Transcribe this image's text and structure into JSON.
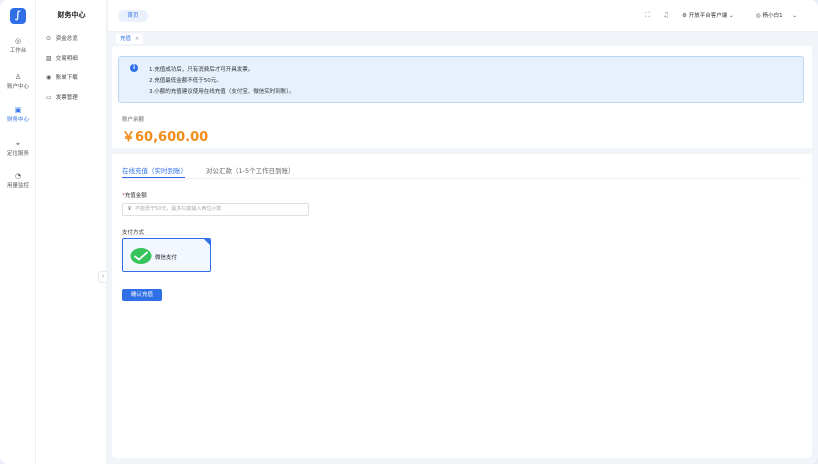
{
  "app": {
    "logo_glyph": "∫",
    "brand_color": "#2f6fe8"
  },
  "rail": {
    "items": [
      {
        "icon": "dashboard-icon",
        "glyph": "◎",
        "label": "工作台"
      },
      {
        "icon": "user-icon",
        "glyph": "♙",
        "label": "账户中心"
      },
      {
        "icon": "finance-icon",
        "glyph": "▣",
        "label": "财务中心",
        "active": true
      },
      {
        "icon": "location-icon",
        "glyph": "⌖",
        "label": "定位服务"
      },
      {
        "icon": "usage-icon",
        "glyph": "◔",
        "label": "用量监控"
      }
    ]
  },
  "submenu": {
    "title": "财务中心",
    "items": [
      {
        "icon": "fund-icon",
        "glyph": "⊙",
        "label": "资金总览"
      },
      {
        "icon": "transaction-icon",
        "glyph": "▨",
        "label": "交易明细"
      },
      {
        "icon": "download-icon",
        "glyph": "◉",
        "label": "账单下载"
      },
      {
        "icon": "invoice-icon",
        "glyph": "▭",
        "label": "发票管理"
      }
    ],
    "collapse_glyph": "‹"
  },
  "topbar": {
    "home_label": "首页",
    "fullscreen_glyph": "⛶",
    "bell_glyph": "♫",
    "platform_glyph": "⚙",
    "platform_label": "开放平台客户端",
    "user_glyph": "◎",
    "user_label": "杨小白1",
    "chevron": "⌄"
  },
  "tabs": {
    "current": "充值",
    "close": "×"
  },
  "notice": {
    "icon_glyph": "i",
    "lines": [
      "1.充值成功后，只有消费后才可开具发票。",
      "2.充值最低金额不低于50元。",
      "3.小额的充值建议使用在线充值（支付宝、微信实时到账）。"
    ]
  },
  "balance": {
    "label": "账户余额",
    "value": "￥60,600.00"
  },
  "pay_tabs": [
    {
      "label": "在线充值（实时到账）",
      "active": true
    },
    {
      "label": "对公汇款（1-5个工作日到账）",
      "active": false
    }
  ],
  "form": {
    "amount_label": "充值金额",
    "required_mark": "*",
    "amount_prefix": "￥",
    "amount_placeholder": "不能低于50元，最多只能输入两位小数",
    "pay_method_label": "支付方式",
    "pay_option": "微信支付",
    "submit_label": "确认充值"
  }
}
